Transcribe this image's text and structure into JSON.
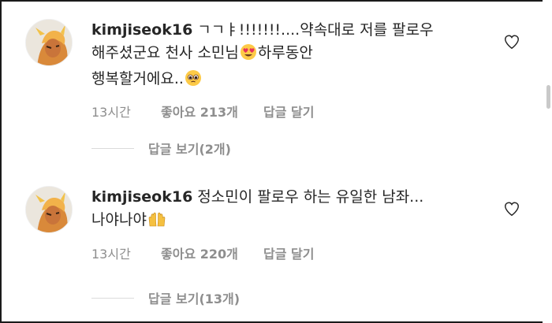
{
  "comments": [
    {
      "username": "kimjiseok16",
      "text_part1": "ㄱㄱㅑ!!!!!!!....약속대로 저를 팔로우\n해주셨군요 천사 소민님",
      "text_part2": "하루동안\n행복할거에요..",
      "emoji1": "smiling-face-with-heart-eyes",
      "emoji2": "pleading-face",
      "time": "13시간",
      "likes": "좋아요 213개",
      "reply_label": "답글 달기",
      "view_replies": "답글 보기(2개)"
    },
    {
      "username": "kimjiseok16",
      "text_part1": "정소민이 팔로우 하는 유일한 남좌...\n나야나야",
      "emoji1": "raising-hands",
      "time": "13시간",
      "likes": "좋아요 220개",
      "reply_label": "답글 달기",
      "view_replies": "답글 보기(13개)"
    }
  ],
  "colors": {
    "text": "#262626",
    "secondary": "#8e8e8e",
    "divider": "#dbdbdb"
  }
}
